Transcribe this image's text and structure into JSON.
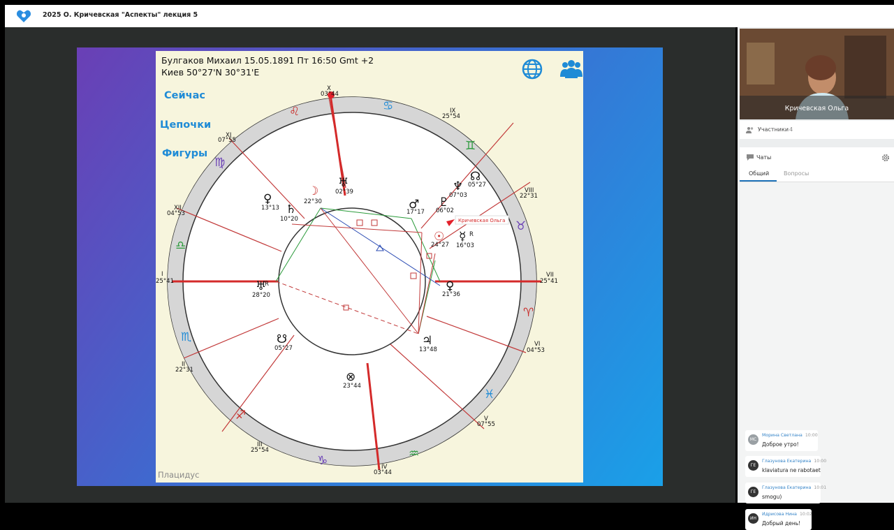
{
  "window": {
    "title": "2025 О. Кричевская \"Аспекты\" лекция 5"
  },
  "chart": {
    "header_line1": "Булгаков Михаил 15.05.1891 Пт 16:50 Gmt +2",
    "header_line2": "Киев 50°27'N 30°31'E",
    "menu": [
      "Сейчас",
      "Цепочки",
      "Фигуры"
    ],
    "footer": "Плацидус",
    "pointer_label": "Кричевская Ольга",
    "house_labels": [
      {
        "num": "X",
        "deg": "03°44"
      },
      {
        "num": "XI",
        "deg": "07°55"
      },
      {
        "num": "IX",
        "deg": "25°54"
      },
      {
        "num": "XII",
        "deg": "04°53"
      },
      {
        "num": "VIII",
        "deg": "22°31"
      },
      {
        "num": "I",
        "deg": "25°41"
      },
      {
        "num": "VII",
        "deg": "25°41"
      },
      {
        "num": "II",
        "deg": "22°31"
      },
      {
        "num": "VI",
        "deg": "04°53"
      },
      {
        "num": "III",
        "deg": "25°54"
      },
      {
        "num": "V",
        "deg": "07°55"
      },
      {
        "num": "IV",
        "deg": "03°44"
      }
    ],
    "planet_labels": [
      {
        "sym": "☽",
        "deg": "22°30"
      },
      {
        "sym": "♅",
        "deg": "02°39"
      },
      {
        "sym": "♂",
        "deg": "17°17"
      },
      {
        "sym": "♆",
        "deg": "07°03"
      },
      {
        "sym": "☊",
        "deg": "05°27"
      },
      {
        "sym": "♇",
        "deg": "06°02"
      },
      {
        "sym": "♀",
        "deg": "13°13"
      },
      {
        "sym": "♄",
        "deg": "10°20"
      },
      {
        "sym": "☉",
        "deg": "24°27"
      },
      {
        "sym": "☿",
        "deg": "16°03",
        "retro": "R"
      },
      {
        "sym": "♅",
        "deg": "28°20",
        "retro": "R"
      },
      {
        "sym": "♀",
        "deg": "21°36"
      },
      {
        "sym": "☋",
        "deg": "05°27"
      },
      {
        "sym": "♃",
        "deg": "13°48"
      },
      {
        "sym": "⊗",
        "deg": "23°44"
      }
    ]
  },
  "sidebar": {
    "video_name": "Кричевская Ольга",
    "participants_label": "Участники",
    "participants_count": "4",
    "chats_label": "Чаты",
    "tabs": [
      "Общий",
      "Вопросы"
    ],
    "messages": [
      {
        "initials": "МС",
        "author": "Морина Светлана",
        "time": "10:00",
        "text": "Доброе утро!"
      },
      {
        "initials": "ГЕ",
        "author": "Глазунова Екатерина",
        "time": "10:00",
        "text": "klaviatura ne rabotaet"
      },
      {
        "initials": "ГЕ",
        "author": "Глазунова Екатерина",
        "time": "10:01",
        "text": "smogu)"
      },
      {
        "initials": "ИН",
        "author": "Идрисова Нина",
        "time": "10:02",
        "text": "Добрый день!"
      }
    ]
  }
}
